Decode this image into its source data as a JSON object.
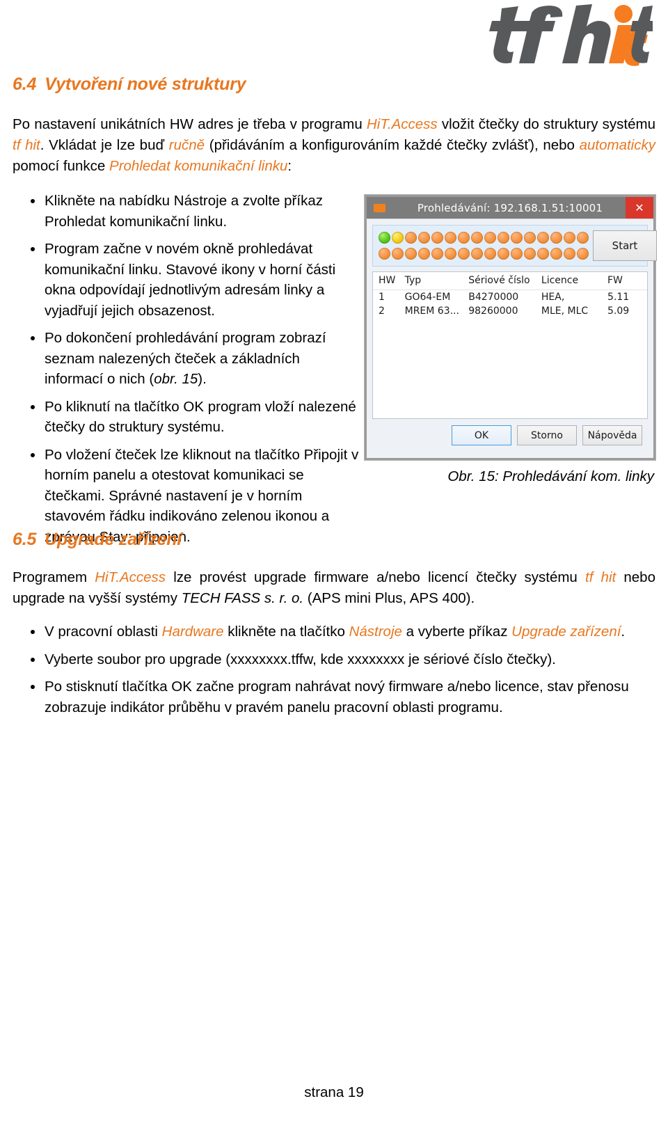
{
  "logo": {
    "text_gray": "tf h",
    "text_orange_i": "i",
    "text_orange_t": "t",
    "alt": "tf hit",
    "color_gray": "#58595B",
    "color_orange": "#F57C20"
  },
  "accent_color": "#E8771F",
  "sections": {
    "s64": {
      "number": "6.4",
      "title": "Vytvoření nové struktury",
      "intro": {
        "p1": "Po nastavení unikátních HW adres je třeba v programu ",
        "em1": "HiT.Access",
        "p2": " vložit čtečky do struktury systému ",
        "em2": "tf hit",
        "p3": ". Vkládat je lze buď ",
        "em3": "ručně",
        "p4": " (přidáváním a konfigurováním každé čtečky zvlášť), nebo ",
        "em4": "automaticky",
        "p5": " pomocí funkce ",
        "em5": "Prohledat komunikační linku",
        "p6": ":"
      },
      "bullets": [
        "Klikněte na nabídku Nástroje a zvolte příkaz Prohledat komunikační linku.",
        "Program začne v novém okně prohledávat komunikační linku. Stavové ikony v horní části okna odpovídají jednotlivým adresám linky a vyjadřují jejich obsazenost.",
        "Po dokončení prohledávání program zobrazí seznam nalezených čteček a základních informací o nich (obr. 15).",
        "Po kliknutí na tlačítko OK program vloží nalezené čtečky do struktury systému.",
        "Po vložení čteček lze kliknout na tlačítko Připojit v horním panelu a otestovat komunikaci se čtečkami. Správné nastavení je v horním stavovém řádku indikováno zelenou ikonou a zprávou Stav: připojen."
      ],
      "bullet3_italic": "obr. 15"
    },
    "s65": {
      "number": "6.5",
      "title": "Upgrade zařízení",
      "intro": {
        "p1": "Programem ",
        "em1": "HiT.Access",
        "p2": " lze provést upgrade firmware a/nebo licencí čtečky systému ",
        "em2": "tf hit",
        "p3": " nebo upgrade na vyšší systémy ",
        "em3": "TECH FASS s. r. o.",
        "p4": " (APS mini Plus, APS 400)."
      },
      "bullets": [
        {
          "p1": "V pracovní oblasti ",
          "em1": "Hardware",
          "p2": " klikněte na tlačítko ",
          "em2": "Nástroje",
          "p3": " a vyberte příkaz ",
          "em3": "Upgrade zařízení",
          "p4": "."
        },
        {
          "plain": "Vyberte soubor pro upgrade (xxxxxxxx.tffw, kde xxxxxxxx je sériové číslo čtečky)."
        },
        {
          "plain": "Po stisknutí tlačítka OK začne program nahrávat nový firmware a/nebo licence, stav přenosu zobrazuje indikátor průběhu v pravém panelu pracovní oblasti programu."
        }
      ]
    }
  },
  "figure": {
    "caption": "Obr. 15: Prohledávání kom. linky",
    "dialog": {
      "title": "Prohledávání: 192.168.1.51:10001",
      "close_label": "✕",
      "start_button": "Start",
      "dots": {
        "rows": 2,
        "columns": 16,
        "statuses": [
          "green",
          "yellow",
          "orange",
          "orange",
          "orange",
          "orange",
          "orange",
          "orange",
          "orange",
          "orange",
          "orange",
          "orange",
          "orange",
          "orange",
          "orange",
          "orange",
          "orange",
          "orange",
          "orange",
          "orange",
          "orange",
          "orange",
          "orange",
          "orange",
          "orange",
          "orange",
          "orange",
          "orange",
          "orange",
          "orange",
          "orange",
          "orange"
        ],
        "colors": {
          "green": "#55c91f",
          "yellow": "#f2cc15",
          "orange": "#f4923f"
        }
      },
      "table": {
        "headers": [
          "HW",
          "Typ",
          "Sériové číslo",
          "Licence",
          "FW"
        ],
        "rows": [
          [
            "1",
            "GO64-EM",
            "B4270000",
            "HEA,",
            "5.11"
          ],
          [
            "2",
            "MREM 63...",
            "98260000",
            "MLE, MLC",
            "5.09"
          ]
        ]
      },
      "buttons": {
        "ok": "OK",
        "cancel": "Storno",
        "help": "Nápověda"
      }
    }
  },
  "footer": {
    "page_label": "strana 19"
  }
}
